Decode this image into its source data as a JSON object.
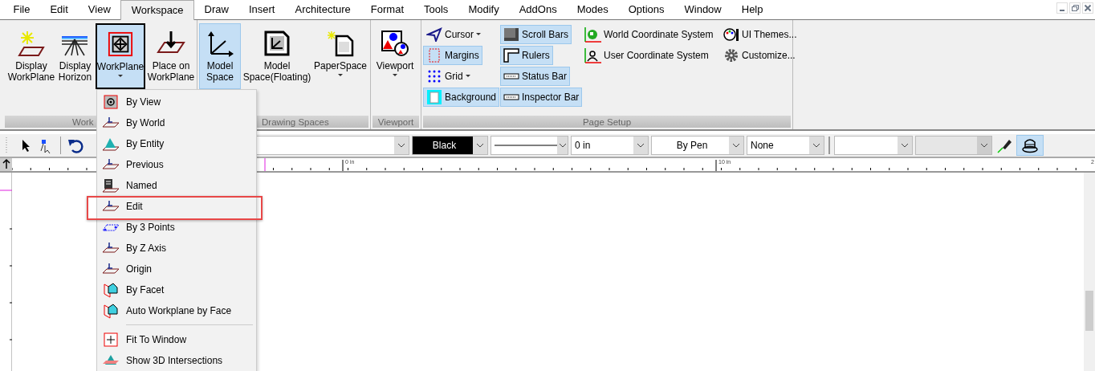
{
  "menu_bar": [
    {
      "label": "File",
      "selected": false
    },
    {
      "label": "Edit",
      "selected": false
    },
    {
      "label": "View",
      "selected": false
    },
    {
      "label": "Workspace",
      "selected": true
    },
    {
      "label": "Draw",
      "selected": false
    },
    {
      "label": "Insert",
      "selected": false
    },
    {
      "label": "Architecture",
      "selected": false
    },
    {
      "label": "Format",
      "selected": false
    },
    {
      "label": "Tools",
      "selected": false
    },
    {
      "label": "Modify",
      "selected": false
    },
    {
      "label": "AddOns",
      "selected": false
    },
    {
      "label": "Modes",
      "selected": false
    },
    {
      "label": "Options",
      "selected": false
    },
    {
      "label": "Window",
      "selected": false
    },
    {
      "label": "Help",
      "selected": false
    }
  ],
  "ribbon": {
    "groups": [
      {
        "label": "Work",
        "buttons": [
          {
            "label": "Display\nWorkPlane",
            "selected": false,
            "open": false,
            "dropdown": false
          },
          {
            "label": "Display\nHorizon",
            "selected": false,
            "open": false,
            "dropdown": false
          },
          {
            "label": "WorkPlane",
            "selected": true,
            "open": true,
            "dropdown": true
          },
          {
            "label": "Place on\nWorkPlane",
            "selected": false,
            "open": false,
            "dropdown": false
          }
        ]
      },
      {
        "label": "Drawing Spaces",
        "buttons": [
          {
            "label": "Model\nSpace",
            "selected": true,
            "open": false,
            "dropdown": false
          },
          {
            "label": "Model\nSpace(Floating)",
            "selected": false,
            "open": false,
            "dropdown": false
          },
          {
            "label": "PaperSpace",
            "selected": false,
            "open": false,
            "dropdown": true
          }
        ]
      },
      {
        "label": "Viewport",
        "buttons": [
          {
            "label": "Viewport",
            "selected": false,
            "open": false,
            "dropdown": true
          }
        ]
      },
      {
        "label": "Page Setup",
        "columns": [
          [
            {
              "label": "Cursor",
              "selected": false,
              "dropdown": true
            },
            {
              "label": "Margins",
              "selected": true,
              "dropdown": false
            },
            {
              "label": "Grid",
              "selected": false,
              "dropdown": true
            },
            {
              "label": "Background",
              "selected": true,
              "dropdown": false
            }
          ],
          [
            {
              "label": "Scroll Bars",
              "selected": true,
              "dropdown": false
            },
            {
              "label": "Rulers",
              "selected": true,
              "dropdown": false
            },
            {
              "label": "Status Bar",
              "selected": true,
              "dropdown": false
            },
            {
              "label": "Inspector Bar",
              "selected": true,
              "dropdown": false
            }
          ],
          [
            {
              "label": "World Coordinate System",
              "selected": false,
              "dropdown": false
            },
            {
              "label": "User Coordinate System",
              "selected": false,
              "dropdown": false
            }
          ],
          [
            {
              "label": "UI Themes...",
              "selected": false,
              "dropdown": false
            },
            {
              "label": "Customize...",
              "selected": false,
              "dropdown": false
            }
          ]
        ]
      }
    ]
  },
  "toolbar": {
    "fields": [
      {
        "kind": "combo",
        "disabled": false
      },
      {
        "kind": "color",
        "value": "Black",
        "disabled": false
      },
      {
        "kind": "line",
        "disabled": false
      },
      {
        "kind": "combo",
        "value": "0 in",
        "disabled": false
      },
      {
        "kind": "combo",
        "value": "By Pen",
        "disabled": false
      },
      {
        "kind": "combo",
        "value": "None",
        "disabled": false
      },
      {
        "kind": "combo",
        "disabled": false
      },
      {
        "kind": "combo",
        "disabled": true
      }
    ],
    "toggle_selected": true
  },
  "ruler": {
    "labels": [
      "0 in",
      "10 in",
      "2"
    ]
  },
  "workplane_menu": [
    {
      "kind": "item",
      "label": "By View",
      "highlighted": false
    },
    {
      "kind": "item",
      "label": "By World",
      "highlighted": false
    },
    {
      "kind": "item",
      "label": "By Entity",
      "highlighted": false
    },
    {
      "kind": "item",
      "label": "Previous",
      "highlighted": false
    },
    {
      "kind": "item",
      "label": "Named",
      "highlighted": false
    },
    {
      "kind": "item",
      "label": "Edit",
      "highlighted": true
    },
    {
      "kind": "item",
      "label": "By 3 Points",
      "highlighted": false
    },
    {
      "kind": "item",
      "label": "By Z Axis",
      "highlighted": false
    },
    {
      "kind": "item",
      "label": "Origin",
      "highlighted": false
    },
    {
      "kind": "item",
      "label": "By Facet",
      "highlighted": false
    },
    {
      "kind": "item",
      "label": "Auto Workplane by Face",
      "highlighted": false
    },
    {
      "kind": "separator"
    },
    {
      "kind": "item",
      "label": "Fit To Window",
      "highlighted": false
    },
    {
      "kind": "item",
      "label": "Show 3D Intersections",
      "highlighted": false
    }
  ]
}
